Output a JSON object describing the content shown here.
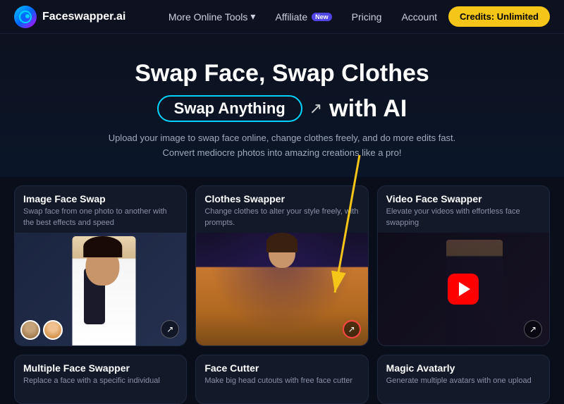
{
  "nav": {
    "logo_text": "Faceswapper.ai",
    "tools_label": "More Online Tools",
    "affiliate_label": "Affiliate",
    "affiliate_badge": "New",
    "pricing_label": "Pricing",
    "account_label": "Account",
    "credits_label": "Credits: Unlimited"
  },
  "hero": {
    "line1": "Swap Face, Swap Clothes",
    "swap_pill": "Swap Anything",
    "link_icon": "↗",
    "with_ai": "with AI",
    "desc1": "Upload your image to swap face online, change clothes freely, and do more edits fast.",
    "desc2": "Convert mediocre photos into amazing creations like a pro!"
  },
  "cards": [
    {
      "id": "image-face-swap",
      "title": "Image Face Swap",
      "desc": "Swap face from one photo to another with the best effects and speed"
    },
    {
      "id": "clothes-swapper",
      "title": "Clothes Swapper",
      "desc": "Change clothes to alter your style freely, with prompts."
    },
    {
      "id": "video-face-swap",
      "title": "Video Face Swapper",
      "desc": "Elevate your videos with effortless face swapping"
    }
  ],
  "bottom_cards": [
    {
      "id": "multiple-face-swapper",
      "title": "Multiple Face Swapper",
      "desc": "Replace a face with a specific individual"
    },
    {
      "id": "face-cutter",
      "title": "Face Cutter",
      "desc": "Make big head cutouts with free face cutter"
    },
    {
      "id": "magic-avatarly",
      "title": "Magic Avatarly",
      "desc": "Generate multiple avatars with one upload"
    }
  ],
  "arrow_label": "↗"
}
